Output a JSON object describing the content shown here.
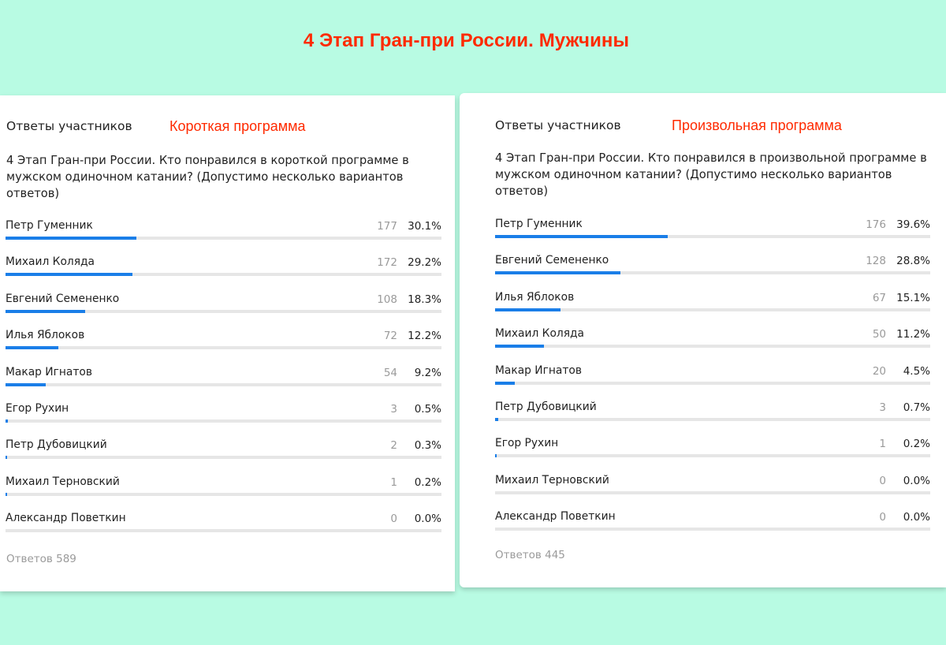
{
  "title": "4 Этап Гран-при России. Мужчины",
  "colors": {
    "background": "#b8fbe3",
    "accent": "#ff2a00",
    "bar": "#1a7ee8",
    "track": "#e6e6e6"
  },
  "panels": [
    {
      "header": "Ответы участников",
      "program": "Короткая программа",
      "question": "4 Этап Гран-при России. Кто понравился в короткой программе в мужском одиночном катании? (Допустимо несколько вариантов ответов)",
      "rows": [
        {
          "name": "Петр Гуменник",
          "count": "177",
          "pct": "30.1%",
          "share": 0.301
        },
        {
          "name": "Михаил Коляда",
          "count": "172",
          "pct": "29.2%",
          "share": 0.292
        },
        {
          "name": "Евгений Семененко",
          "count": "108",
          "pct": "18.3%",
          "share": 0.183
        },
        {
          "name": "Илья Яблоков",
          "count": "72",
          "pct": "12.2%",
          "share": 0.122
        },
        {
          "name": "Макар Игнатов",
          "count": "54",
          "pct": "9.2%",
          "share": 0.092
        },
        {
          "name": "Егор Рухин",
          "count": "3",
          "pct": "0.5%",
          "share": 0.005
        },
        {
          "name": "Петр Дубовицкий",
          "count": "2",
          "pct": "0.3%",
          "share": 0.003
        },
        {
          "name": "Михаил Терновский",
          "count": "1",
          "pct": "0.2%",
          "share": 0.002
        },
        {
          "name": "Александр Поветкин",
          "count": "0",
          "pct": "0.0%",
          "share": 0.0
        }
      ],
      "total": "Ответов 589"
    },
    {
      "header": "Ответы участников",
      "program": "Произвольная программа",
      "question": "4 Этап Гран-при России. Кто понравился в произвольной программе в мужском одиночном катании? (Допустимо несколько вариантов ответов)",
      "rows": [
        {
          "name": "Петр Гуменник",
          "count": "176",
          "pct": "39.6%",
          "share": 0.396
        },
        {
          "name": "Евгений Семененко",
          "count": "128",
          "pct": "28.8%",
          "share": 0.288
        },
        {
          "name": "Илья Яблоков",
          "count": "67",
          "pct": "15.1%",
          "share": 0.151
        },
        {
          "name": "Михаил Коляда",
          "count": "50",
          "pct": "11.2%",
          "share": 0.112
        },
        {
          "name": "Макар Игнатов",
          "count": "20",
          "pct": "4.5%",
          "share": 0.045
        },
        {
          "name": "Петр Дубовицкий",
          "count": "3",
          "pct": "0.7%",
          "share": 0.007
        },
        {
          "name": "Егор Рухин",
          "count": "1",
          "pct": "0.2%",
          "share": 0.002
        },
        {
          "name": "Михаил Терновский",
          "count": "0",
          "pct": "0.0%",
          "share": 0.0
        },
        {
          "name": "Александр Поветкин",
          "count": "0",
          "pct": "0.0%",
          "share": 0.0
        }
      ],
      "total": "Ответов 445"
    }
  ]
}
